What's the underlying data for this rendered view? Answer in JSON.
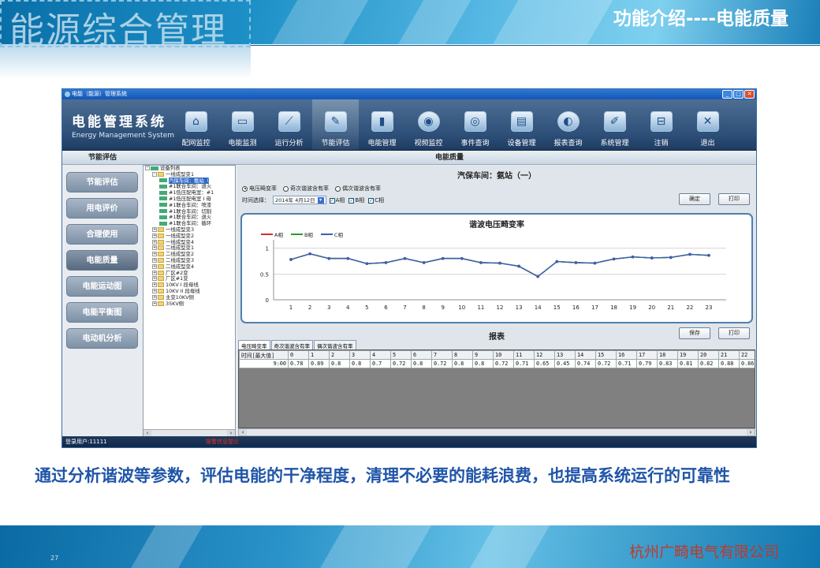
{
  "slide": {
    "big_title": "能源综合管理",
    "subtitle": "功能介绍----电能质量",
    "caption": "通过分析谐波等参数，评估电能的干净程度，清理不必要的能耗浪费，也提高系统运行的可靠性",
    "company": "杭州广畸电气有限公司",
    "page_number": "27"
  },
  "window": {
    "title": "电能（能源）管理系统",
    "brand_cn": "电能管理系统",
    "brand_en": "Energy Management System",
    "nav": [
      {
        "label": "配网监控",
        "icon": "home-icon",
        "glyph": "⌂"
      },
      {
        "label": "电能监测",
        "icon": "monitor-icon",
        "glyph": "▭"
      },
      {
        "label": "运行分析",
        "icon": "trend-icon",
        "glyph": "⟋"
      },
      {
        "label": "节能评估",
        "icon": "clipboard-icon",
        "glyph": "✎",
        "active": true
      },
      {
        "label": "电能管理",
        "icon": "battery-icon",
        "glyph": "▮"
      },
      {
        "label": "视频监控",
        "icon": "camera-icon",
        "glyph": "◉"
      },
      {
        "label": "事件查询",
        "icon": "eye-icon",
        "glyph": "◎"
      },
      {
        "label": "设备管理",
        "icon": "device-icon",
        "glyph": "▤"
      },
      {
        "label": "报表查询",
        "icon": "disc-icon",
        "glyph": "◐"
      },
      {
        "label": "系统管理",
        "icon": "pen-icon",
        "glyph": "✐"
      },
      {
        "label": "注销",
        "icon": "logout-icon",
        "glyph": "⊟"
      },
      {
        "label": "退出",
        "icon": "exit-icon",
        "glyph": "✕"
      }
    ],
    "left_header": "节能评估",
    "left_buttons": [
      "节能评估",
      "用电评价",
      "合理使用",
      "电能质量",
      "电能运动图",
      "电能平衡图",
      "电动机分析"
    ],
    "left_active": "电能质量",
    "main_header": "电能质量",
    "tree": [
      {
        "t": "设备列表",
        "lvl": 0,
        "kind": "root",
        "pm": "-"
      },
      {
        "t": "一线成型变1",
        "lvl": 1,
        "kind": "folder",
        "pm": "-"
      },
      {
        "t": "汽保车间：氨站（",
        "lvl": 2,
        "kind": "leaf",
        "sel": true
      },
      {
        "t": "#1联合车间：退火",
        "lvl": 2,
        "kind": "leaf"
      },
      {
        "t": "#1低压配电室：#1",
        "lvl": 2,
        "kind": "leaf"
      },
      {
        "t": "#1低压配电室 I 母",
        "lvl": 2,
        "kind": "leaf"
      },
      {
        "t": "#1联合车间：喷漆",
        "lvl": 2,
        "kind": "leaf"
      },
      {
        "t": "#1联合车间：切割",
        "lvl": 2,
        "kind": "leaf"
      },
      {
        "t": "#1联合车间：退火",
        "lvl": 2,
        "kind": "leaf"
      },
      {
        "t": "#1联合车间：循环",
        "lvl": 2,
        "kind": "leaf"
      },
      {
        "t": "一线成型变3",
        "lvl": 1,
        "kind": "folder",
        "pm": "+"
      },
      {
        "t": "一线成型变2",
        "lvl": 1,
        "kind": "folder",
        "pm": "+"
      },
      {
        "t": "一线成型变4",
        "lvl": 1,
        "kind": "folder",
        "pm": "+"
      },
      {
        "t": "二线成型变1",
        "lvl": 1,
        "kind": "folder",
        "pm": "+"
      },
      {
        "t": "二线成型变2",
        "lvl": 1,
        "kind": "folder",
        "pm": "+"
      },
      {
        "t": "二线成型变3",
        "lvl": 1,
        "kind": "folder",
        "pm": "+"
      },
      {
        "t": "二线成型变4",
        "lvl": 1,
        "kind": "folder",
        "pm": "+"
      },
      {
        "t": "厂区#2变",
        "lvl": 1,
        "kind": "folder",
        "pm": "+"
      },
      {
        "t": "厂区#1变",
        "lvl": 1,
        "kind": "folder",
        "pm": "+"
      },
      {
        "t": "10KV I 段母线",
        "lvl": 1,
        "kind": "folder",
        "pm": "+"
      },
      {
        "t": "10KV II 段母线",
        "lvl": 1,
        "kind": "folder",
        "pm": "+"
      },
      {
        "t": "主变10KV侧",
        "lvl": 1,
        "kind": "folder",
        "pm": "+"
      },
      {
        "t": "35KV侧",
        "lvl": 1,
        "kind": "folder",
        "pm": "+"
      }
    ],
    "station_title": "汽保车间：氨站（一）",
    "radios": [
      {
        "label": "电压畸变率",
        "checked": true
      },
      {
        "label": "奇次谐波含有率",
        "checked": false
      },
      {
        "label": "偶次谐波含有率",
        "checked": false
      }
    ],
    "time_label": "时间选择：",
    "date_value": "2014年 4月12日",
    "phases": [
      "A相",
      "B相",
      "C相"
    ],
    "confirm_label": "确定",
    "print_label": "打印",
    "report_title": "报表",
    "save_label": "保存",
    "print2_label": "打印",
    "report_tabs": [
      "电压畸变率",
      "奇次谐波含有率",
      "偶次谐波含有率"
    ],
    "table_header_first": "时间[最大值]",
    "table_hours": [
      "0",
      "1",
      "2",
      "3",
      "4",
      "5",
      "6",
      "7",
      "8",
      "9",
      "10",
      "11",
      "12",
      "13",
      "14",
      "15",
      "16",
      "17",
      "18",
      "19",
      "20",
      "21",
      "22"
    ],
    "table_row_time": "9:00",
    "table_row_values": [
      "0.78",
      "0.89",
      "0.8",
      "0.8",
      "0.7",
      "0.72",
      "0.8",
      "0.72",
      "0.8",
      "0.8",
      "0.72",
      "0.71",
      "0.65",
      "0.45",
      "0.74",
      "0.72",
      "0.71",
      "0.79",
      "0.83",
      "0.81",
      "0.82",
      "0.88",
      "0.86"
    ],
    "status_user": "登录用户:11111",
    "status_warning": "报警信息提示"
  },
  "chart_data": {
    "type": "line",
    "title": "谐波电压畸变率",
    "x": [
      1,
      2,
      3,
      4,
      5,
      6,
      7,
      8,
      9,
      10,
      11,
      12,
      13,
      14,
      15,
      16,
      17,
      18,
      19,
      20,
      21,
      22,
      23
    ],
    "series": [
      {
        "name": "A相",
        "color": "#d03030",
        "values": [
          0.78,
          0.89,
          0.8,
          0.8,
          0.7,
          0.72,
          0.8,
          0.72,
          0.8,
          0.8,
          0.72,
          0.71,
          0.65,
          0.45,
          0.74,
          0.72,
          0.71,
          0.79,
          0.83,
          0.81,
          0.82,
          0.88,
          0.86
        ]
      },
      {
        "name": "B相",
        "color": "#2a9a2a",
        "values": [
          0.78,
          0.89,
          0.8,
          0.8,
          0.7,
          0.72,
          0.8,
          0.72,
          0.8,
          0.8,
          0.72,
          0.71,
          0.65,
          0.45,
          0.74,
          0.72,
          0.71,
          0.79,
          0.83,
          0.81,
          0.82,
          0.88,
          0.86
        ]
      },
      {
        "name": "C相",
        "color": "#3a5fb0",
        "values": [
          0.78,
          0.89,
          0.8,
          0.8,
          0.7,
          0.72,
          0.8,
          0.72,
          0.8,
          0.8,
          0.72,
          0.71,
          0.65,
          0.45,
          0.74,
          0.72,
          0.71,
          0.79,
          0.83,
          0.81,
          0.82,
          0.88,
          0.86
        ]
      }
    ],
    "y_ticks": [
      0,
      0.5,
      1
    ],
    "ylim": [
      0,
      1.1
    ],
    "grid": true,
    "legend": "top-left"
  }
}
